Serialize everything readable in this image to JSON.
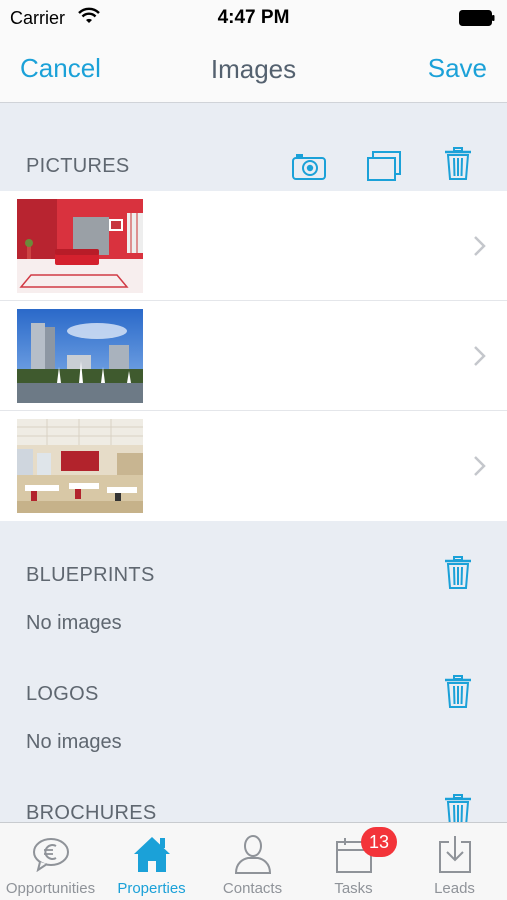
{
  "status_bar": {
    "carrier": "Carrier",
    "time": "4:47 PM"
  },
  "nav": {
    "cancel_label": "Cancel",
    "title": "Images",
    "save_label": "Save"
  },
  "sections": {
    "pictures": {
      "header": "PICTURES",
      "items_count": 3
    },
    "blueprints": {
      "header": "BLUEPRINTS",
      "empty": "No images"
    },
    "logos": {
      "header": "LOGOS",
      "empty": "No images"
    },
    "brochures": {
      "header": "BROCHURES"
    }
  },
  "tab_bar": {
    "tabs": [
      {
        "label": "Opportunities",
        "icon": "euro-bubble-icon"
      },
      {
        "label": "Properties",
        "icon": "house-icon",
        "active": true
      },
      {
        "label": "Contacts",
        "icon": "person-icon"
      },
      {
        "label": "Tasks",
        "icon": "calendar-icon",
        "badge": "13"
      },
      {
        "label": "Leads",
        "icon": "download-tray-icon"
      }
    ]
  },
  "colors": {
    "accent": "#1ba1d8",
    "badge": "#f3343a",
    "background": "#e9edf3"
  }
}
